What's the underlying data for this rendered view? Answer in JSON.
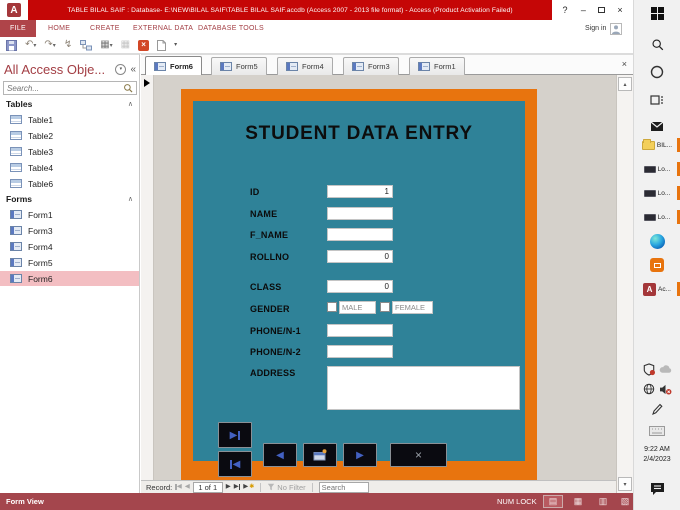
{
  "title_bar": {
    "title": "TABLE BILAL SAIF : Database- E:\\NEW\\BILAL SAIF\\TABLE BILAL SAIF.accdb (Access 2007 - 2013 file format) - Access (Product Activation Failed)",
    "app_initial": "A",
    "help": "?",
    "minimize": "–",
    "close": "×"
  },
  "ribbon": {
    "file": "FILE",
    "tabs": [
      "HOME",
      "CREATE",
      "EXTERNAL DATA",
      "DATABASE TOOLS"
    ],
    "sign_in": "Sign in"
  },
  "sidebar": {
    "title": "All Access Obje...",
    "search_placeholder": "Search...",
    "tables_header": "Tables",
    "tables": [
      "Table1",
      "Table2",
      "Table3",
      "Table4",
      "Table6"
    ],
    "forms_header": "Forms",
    "forms": [
      "Form1",
      "Form3",
      "Form4",
      "Form5",
      "Form6"
    ],
    "selected_item": "Form6"
  },
  "doc_tabs": [
    "Form6",
    "Form5",
    "Form4",
    "Form3",
    "Form1"
  ],
  "form": {
    "title": "STUDENT DATA ENTRY",
    "labels": {
      "id": "ID",
      "name": "NAME",
      "f_name": "F_NAME",
      "rollno": "ROLLNO",
      "class": "CLASS",
      "gender": "GENDER",
      "phone1": "PHONE/N-1",
      "phone2": "PHONE/N-2",
      "address": "ADDRESS"
    },
    "values": {
      "id": "1",
      "name": "",
      "f_name": "",
      "rollno": "0",
      "class": "0",
      "phone1": "",
      "phone2": "",
      "address": ""
    },
    "gender_options": [
      "MALE",
      "FEMALE"
    ]
  },
  "record_nav": {
    "label": "Record:",
    "position": "1 of 1",
    "no_filter": "No Filter",
    "search_placeholder": "Search"
  },
  "status_bar": {
    "view": "Form View",
    "num_lock": "NUM LOCK"
  },
  "taskbar": {
    "folder_label": "BIL...",
    "window_labels": [
      "Lo...",
      "Lo...",
      "Lo..."
    ],
    "access_label": "Ac...",
    "clock": {
      "time": "9:22 AM",
      "date": "2/4/2023"
    }
  },
  "colors": {
    "title_red": "#C50606",
    "theme_red": "#A4373A",
    "status_red": "#A4464D",
    "form_orange": "#E8740E",
    "form_teal": "#2F8298",
    "selection_pink": "#F3BEC2",
    "button_black": "#0A0A10",
    "arrow_blue": "#4361C2"
  },
  "icons": {
    "qat": [
      "save-icon",
      "undo-icon",
      "redo-icon",
      "run-macro-icon",
      "relationships-icon",
      "table-grid-icon",
      "table-grid-disabled-icon",
      "close-red-icon",
      "new-document-icon",
      "qat-customize-icon"
    ],
    "status_views": [
      "form-view-icon",
      "datasheet-view-icon",
      "layout-view-icon",
      "design-view-icon"
    ]
  }
}
